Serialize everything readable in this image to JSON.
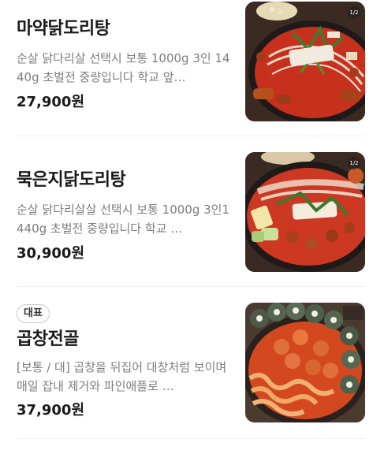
{
  "menu": [
    {
      "name": "마약닭도리탕",
      "description": "순살 닭다리살 선택시 보통 1000g 3인 1440g 초벌전 중량입니다 학교 앞…",
      "price": "27,900원",
      "image_counter": "1/2",
      "image_icon": "spicy-chicken-stew-photo"
    },
    {
      "name": "묵은지닭도리탕",
      "description": "순살 닭다리살살 선택시 보통 1000g 3인1440g 초벌전 중량입니다 학교 …",
      "price": "30,900원",
      "image_counter": "1/2",
      "image_icon": "kimchi-chicken-stew-photo"
    },
    {
      "badge": "대표",
      "name": "곱창전골",
      "description": "[보통 / 대] 곱창을 뒤집어 대창처럼 보이며 매일 잡내 제거와 파인애플로 …",
      "price": "37,900원",
      "image_icon": "gopchang-hotpot-photo"
    }
  ],
  "colors": {
    "stew_red": "#c8301e",
    "pot_dark": "#2b2220",
    "price_text": "#1a1a1a",
    "desc_text": "#7d7d7d"
  }
}
